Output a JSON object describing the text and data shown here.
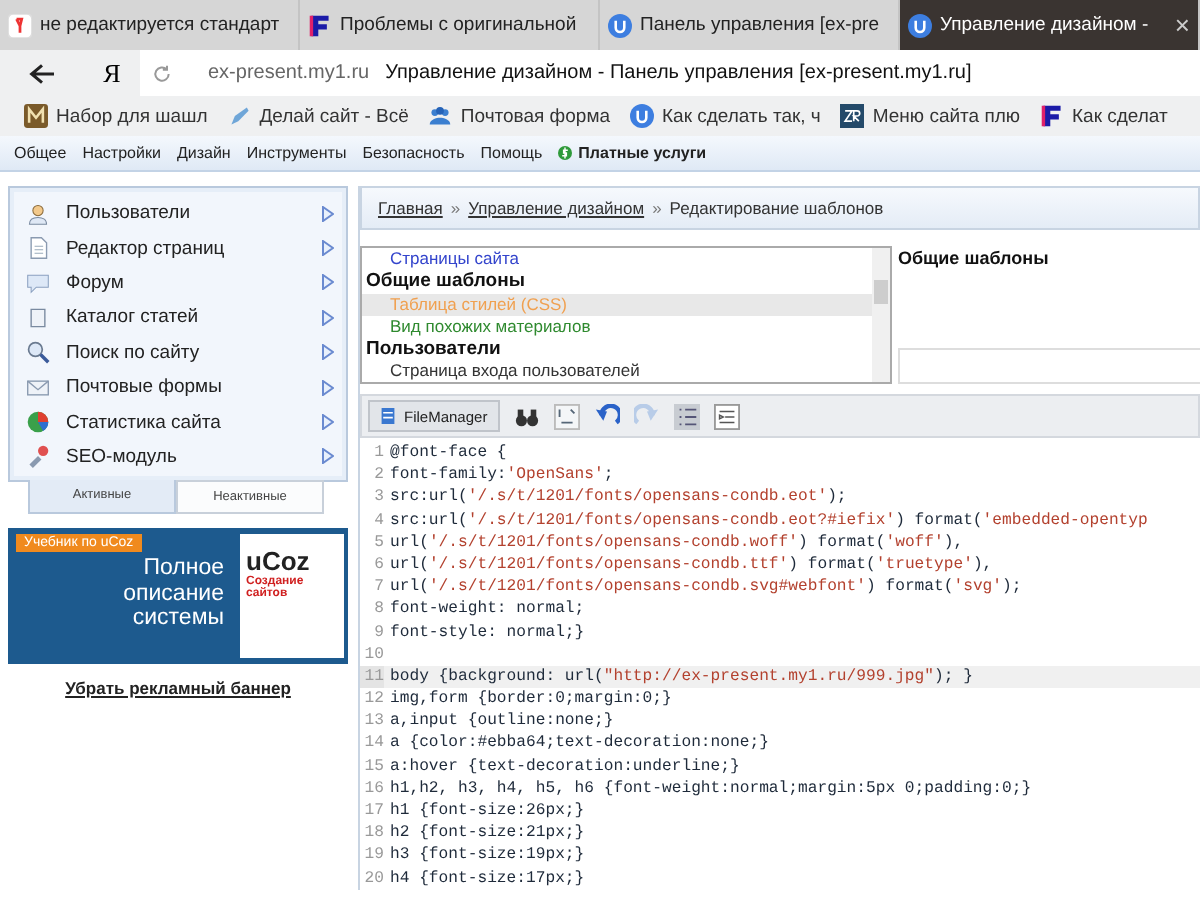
{
  "browser_tabs": [
    {
      "title": "не редактируется стандарт",
      "selected": false
    },
    {
      "title": "Проблемы с оригинальной",
      "selected": false
    },
    {
      "title": "Панель управления [ex-pre",
      "selected": false
    },
    {
      "title": "Управление дизайном -",
      "selected": true
    }
  ],
  "close_tab": "×",
  "address_bar": {
    "logo": "Я",
    "domain": "ex-present.my1.ru",
    "page_title": "Управление дизайном - Панель управления [ex-present.my1.ru]"
  },
  "bookmarks": [
    "Набор для шашл",
    "Делай сайт - Всё",
    "Почтовая форма",
    "Как сделать так, ч",
    "Меню сайта плю",
    "Как сделат"
  ],
  "admin_menu": [
    {
      "label": "Общее",
      "kind": "plain"
    },
    {
      "label": "Настройки",
      "kind": "plain"
    },
    {
      "label": "Дизайн",
      "kind": "plain"
    },
    {
      "label": "Инструменты",
      "kind": "plain"
    },
    {
      "label": "Безопасность",
      "kind": "plain"
    },
    {
      "label": "Помощь",
      "kind": "plain"
    },
    {
      "label": "Платные услуги",
      "kind": "paid"
    }
  ],
  "sidebar": {
    "items": [
      "Пользователи",
      "Редактор страниц",
      "Форум",
      "Каталог статей",
      "Поиск по сайту",
      "Почтовые формы",
      "Статистика сайта",
      "SEO-модуль"
    ],
    "tabs": [
      {
        "label": "Активные",
        "selected": true
      },
      {
        "label": "Неактивные",
        "selected": false
      }
    ],
    "banner": {
      "ribbon": "Учебник по uCoz",
      "headline": "Полное описание системы",
      "book_title": "uCoz",
      "book_subtitle": "Создание сайтов"
    },
    "remove_banner_link": "Убрать рекламный баннер"
  },
  "breadcrumb": [
    {
      "label": "Главная",
      "link": true
    },
    {
      "label": "Управление дизайном",
      "link": true
    },
    {
      "label": "Редактирование шаблонов",
      "link": false
    }
  ],
  "breadcrumb_separator": "»",
  "templates": {
    "items": [
      {
        "label": "Страницы сайта",
        "kind": "item",
        "color": "#3344cc",
        "selected": false
      },
      {
        "label": "Общие шаблоны",
        "kind": "heading",
        "selected": false
      },
      {
        "label": "Таблица стилей (CSS)",
        "kind": "item",
        "color": "#f0a050",
        "selected": true
      },
      {
        "label": "Вид похожих материалов",
        "kind": "item",
        "color": "#2f8a2f",
        "selected": false
      },
      {
        "label": "Пользователи",
        "kind": "heading",
        "selected": false
      },
      {
        "label": "Страница входа пользователей",
        "kind": "item",
        "color": "#333333",
        "selected": false
      }
    ],
    "section_title": "Общие шаблоны"
  },
  "toolbar": {
    "file_manager": "FileManager"
  },
  "code": [
    {
      "n": "1",
      "highlighted": false,
      "text": "@font-face {"
    },
    {
      "n": "2",
      "highlighted": false,
      "text": "font-family:'OpenSans';"
    },
    {
      "n": "3",
      "highlighted": false,
      "text": "src:url('/.s/t/1201/fonts/opensans-condb.eot');"
    },
    {
      "n": "4",
      "highlighted": false,
      "text": "src:url('/.s/t/1201/fonts/opensans-condb.eot?#iefix') format('embedded-opentyp"
    },
    {
      "n": "5",
      "highlighted": false,
      "text": "url('/.s/t/1201/fonts/opensans-condb.woff') format('woff'),"
    },
    {
      "n": "6",
      "highlighted": false,
      "text": "url('/.s/t/1201/fonts/opensans-condb.ttf') format('truetype'),"
    },
    {
      "n": "7",
      "highlighted": false,
      "text": "url('/.s/t/1201/fonts/opensans-condb.svg#webfont') format('svg');"
    },
    {
      "n": "8",
      "highlighted": false,
      "text": "font-weight: normal;"
    },
    {
      "n": "9",
      "highlighted": false,
      "text": "font-style: normal;}"
    },
    {
      "n": "10",
      "highlighted": false
    },
    {
      "n": "11",
      "highlighted": true,
      "text": "body {background: url(\"http://ex-present.my1.ru/999.jpg\"); }"
    },
    {
      "n": "12",
      "highlighted": false,
      "text": "img,form {border:0;margin:0;}"
    },
    {
      "n": "13",
      "highlighted": false,
      "text": "a,input {outline:none;}"
    },
    {
      "n": "14",
      "highlighted": false,
      "text": "a {color:#ebba64;text-decoration:none;}"
    },
    {
      "n": "15",
      "highlighted": false,
      "text": "a:hover {text-decoration:underline;}"
    },
    {
      "n": "16",
      "highlighted": false,
      "text": "h1,h2, h3, h4, h5, h6 {font-weight:normal;margin:5px 0;padding:0;}"
    },
    {
      "n": "17",
      "highlighted": false,
      "text": "h1 {font-size:26px;}"
    },
    {
      "n": "18",
      "highlighted": false,
      "text": "h2 {font-size:21px;}"
    },
    {
      "n": "19",
      "highlighted": false,
      "text": "h3 {font-size:19px;}"
    },
    {
      "n": "20",
      "highlighted": false,
      "text": "h4 {font-size:17px;}"
    }
  ]
}
